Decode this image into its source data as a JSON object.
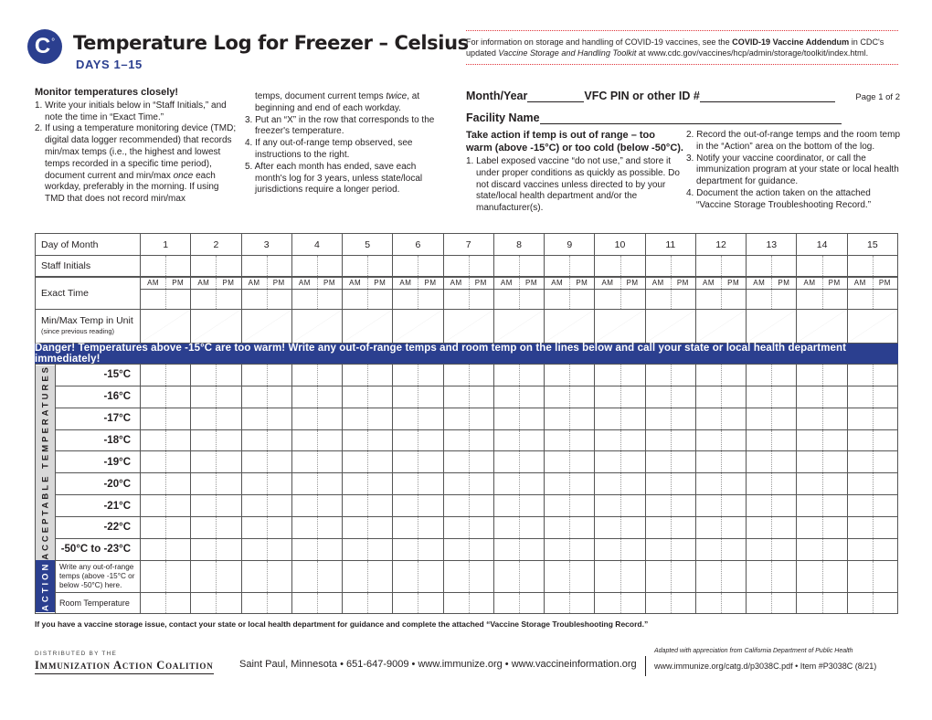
{
  "header": {
    "logo_text": "C",
    "logo_degree": "°",
    "title": "Temperature Log for Freezer – Celsius",
    "subtitle": "DAYS 1–15",
    "info": {
      "pre": "For information on storage and handling of COVID-19 vaccines, see the ",
      "bold": "COVID-19 Vaccine Addendum",
      "mid": " in CDC's updated ",
      "italic": "Vaccine Storage and Handling Toolkit",
      "post": " at www.cdc.gov/vaccines/hcp/admin/storage/toolkit/index.html."
    }
  },
  "monitor": {
    "heading": "Monitor temperatures closely!",
    "items": [
      "1. Write your initials below in “Staff Initials,” and note the time in “Exact Time.”",
      "2. If using a temperature monitoring device (TMD; digital data logger recommended) that records min/max temps (i.e., the highest and lowest temps recorded in a specific time period), document current and min/max once each workday, preferably in the morning. If using TMD that does not record min/max temps, document current temps twice, at beginning and end of each workday.",
      "3. Put an “X” in the row that corresponds to the freezer's temperature.",
      "4. If any out-of-range temp observed, see instructions to the right.",
      "5. After each month has ended, save each month's log for 3 years, unless state/local jurisdictions require a longer period."
    ],
    "item2_part1": "2. If using a temperature monitoring device (TMD; digital data logger recommended) that records min/max temps (i.e., the highest and lowest temps recorded in a specific time period), document current and min/max ",
    "item2_once": "once",
    "item2_part2": " each workday, preferably in the morning. If using TMD that does not record min/max",
    "item2_cont1": "temps, document current temps ",
    "item2_twice": "twice",
    "item2_cont2": ", at beginning and end of each workday."
  },
  "fields": {
    "month_year": "Month/Year",
    "vfc_pin": "VFC PIN or other ID #",
    "page": "Page 1 of 2",
    "facility": "Facility Name"
  },
  "action_instructions": {
    "heading": "Take action if temp is out of range – too warm (above -15°C) or too cold (below -50°C).",
    "items": [
      "1. Label exposed vaccine “do not use,” and store it under proper conditions as quickly as possible. Do not discard vaccines unless directed to by your state/local health department and/or the manufacturer(s).",
      "2. Record the out-of-range temps and the room temp in the “Action” area on the bottom of the log.",
      "3. Notify your vaccine coordinator, or call the immunization program at your state or local health department for guidance.",
      "4. Document the action taken on the attached “Vaccine Storage Troubleshooting Record.”"
    ]
  },
  "table": {
    "row_labels": {
      "day": "Day of Month",
      "initials": "Staff Initials",
      "time": "Exact Time",
      "minmax": "Min/Max Temp in Unit",
      "minmax_sub": "(since previous reading)"
    },
    "am": "AM",
    "pm": "PM",
    "days": [
      "1",
      "2",
      "3",
      "4",
      "5",
      "6",
      "7",
      "8",
      "9",
      "10",
      "11",
      "12",
      "13",
      "14",
      "15"
    ]
  },
  "danger_banner": "Danger! Temperatures above -15°C are too warm! Write any out-of-range temps and room temp on the lines below and call your state or local health department immediately!",
  "temps": {
    "acceptable_label": "ACCEPTABLE TEMPERATURES",
    "action_label": "ACTION",
    "rows": [
      "-15°C",
      "-16°C",
      "-17°C",
      "-18°C",
      "-19°C",
      "-20°C",
      "-21°C",
      "-22°C",
      "-50°C to -23°C"
    ],
    "out_of_range": "Write any out-of-range temps (above -15°C or below -50°C) here.",
    "room_temp": "Room Temperature"
  },
  "footer": {
    "note": "If you have a vaccine storage issue, contact your state or local health department for guidance and complete the attached “Vaccine Storage Troubleshooting Record.”",
    "distributed_by": "DISTRIBUTED BY THE",
    "org": "Immunization Action Coalition",
    "contact": "Saint Paul, Minnesota • 651-647-9009 • www.immunize.org • www.vaccineinformation.org",
    "adapted": "Adapted with appreciation from California Department of Public Health",
    "item": "www.immunize.org/catg.d/p3038C.pdf • Item #P3038C (8/21)"
  },
  "colors": {
    "brand_blue": "#2b3f8f",
    "dotted_red": "#e0343a",
    "band_gray": "#d9d9d9"
  }
}
